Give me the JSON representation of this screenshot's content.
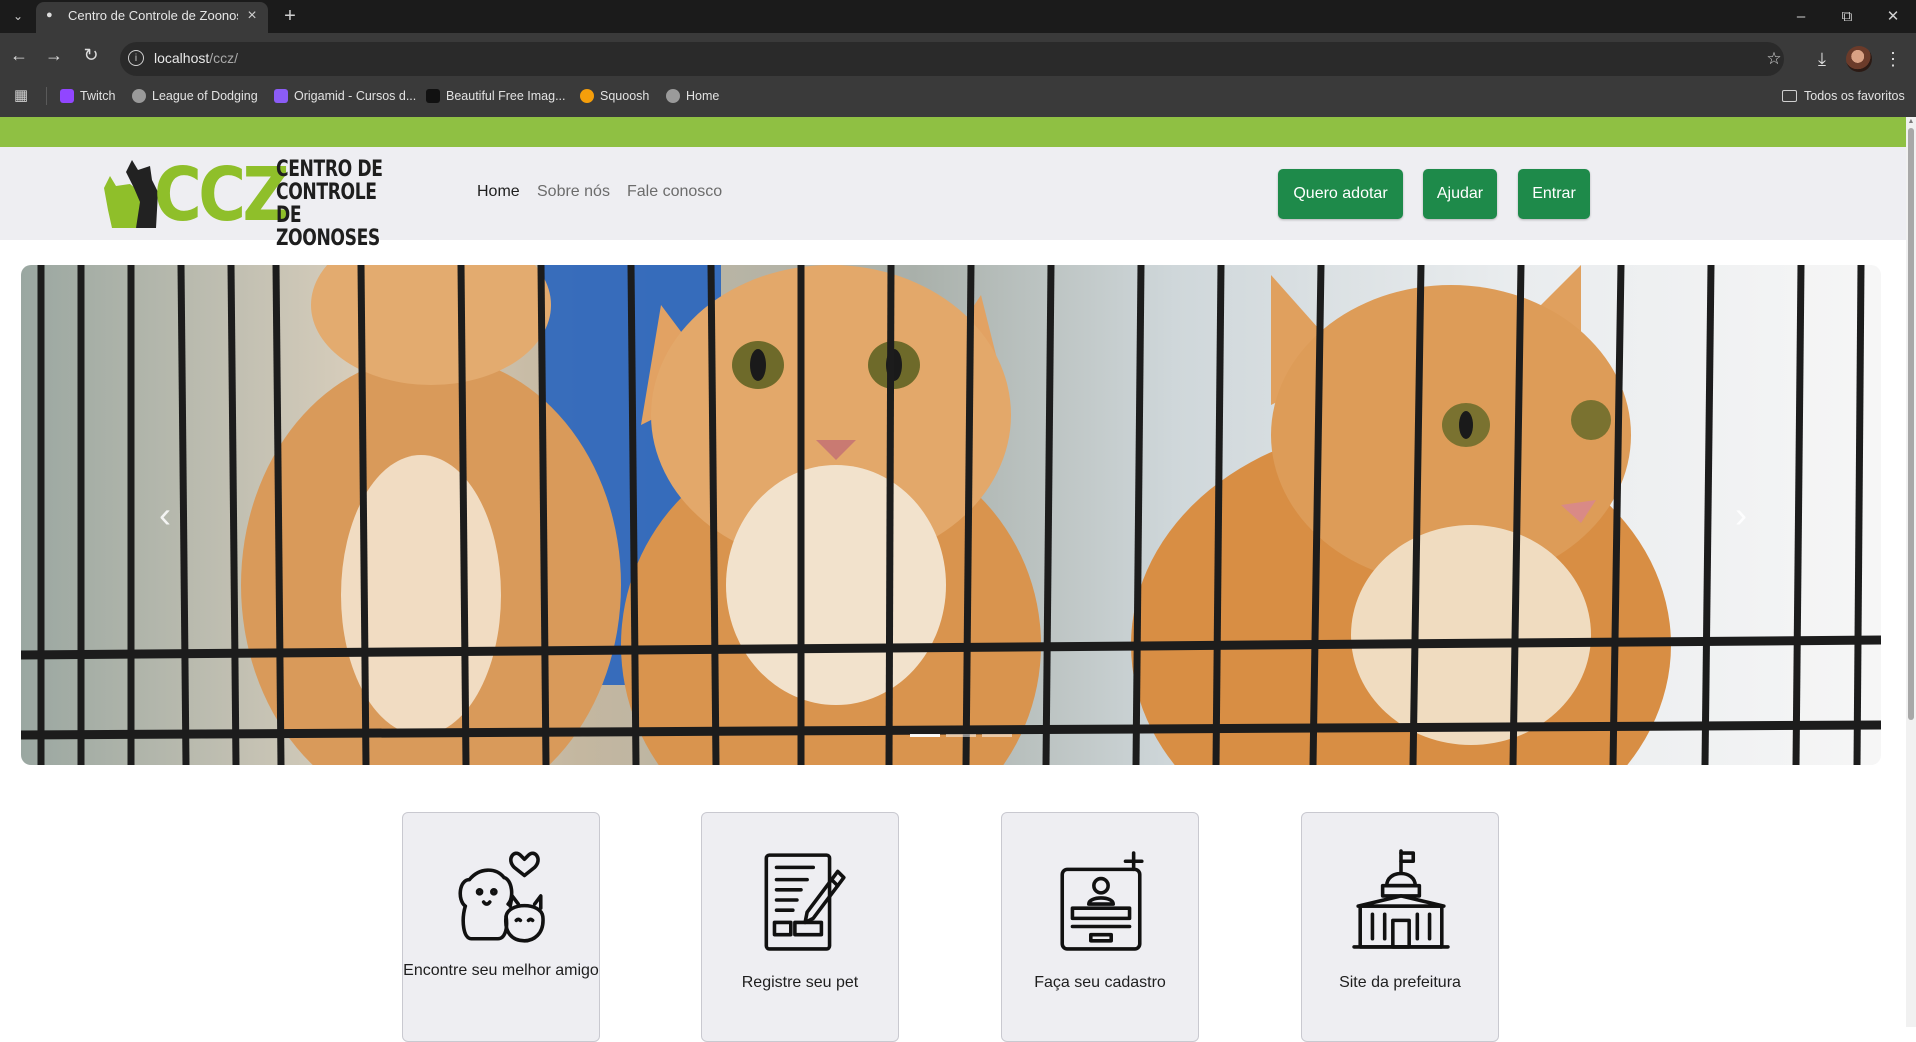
{
  "browser": {
    "tab_title": "Centro de Controle de Zoonoses",
    "url_host": "localhost",
    "url_path": "/ccz/",
    "bookmarks": [
      {
        "label": "Twitch",
        "color": "#9146ff"
      },
      {
        "label": "League of Dodging",
        "color": "#9a9a9a"
      },
      {
        "label": "Origamid - Cursos d...",
        "color": "#8b5cf6"
      },
      {
        "label": "Beautiful Free Imag...",
        "color": "#111111"
      },
      {
        "label": "Squoosh",
        "color": "#f59e0b"
      },
      {
        "label": "Home",
        "color": "#9a9a9a"
      }
    ],
    "all_bookmarks_label": "Todos os favoritos"
  },
  "site": {
    "accent_color": "#8fc043",
    "logo": {
      "ccz": "CCZ",
      "line1": "CENTRO DE",
      "line2": "CONTROLE",
      "line3": "DE ZOONOSES"
    },
    "nav": [
      {
        "label": "Home",
        "active": true
      },
      {
        "label": "Sobre nós",
        "active": false
      },
      {
        "label": "Fale conosco",
        "active": false
      }
    ],
    "buttons": {
      "adopt": "Quero adotar",
      "help": "Ajudar",
      "login": "Entrar"
    },
    "button_color": "#1e8a4a"
  },
  "carousel": {
    "prev_icon": "chevron-left-icon",
    "next_icon": "chevron-right-icon",
    "slides": 3,
    "active_slide": 1
  },
  "cards": [
    {
      "label": "Encontre seu melhor amigo",
      "icon": "dog-cat-heart-icon"
    },
    {
      "label": "Registre seu pet",
      "icon": "document-pen-icon"
    },
    {
      "label": "Faça seu cadastro",
      "icon": "id-card-add-icon"
    },
    {
      "label": "Site da prefeitura",
      "icon": "city-hall-icon"
    }
  ]
}
